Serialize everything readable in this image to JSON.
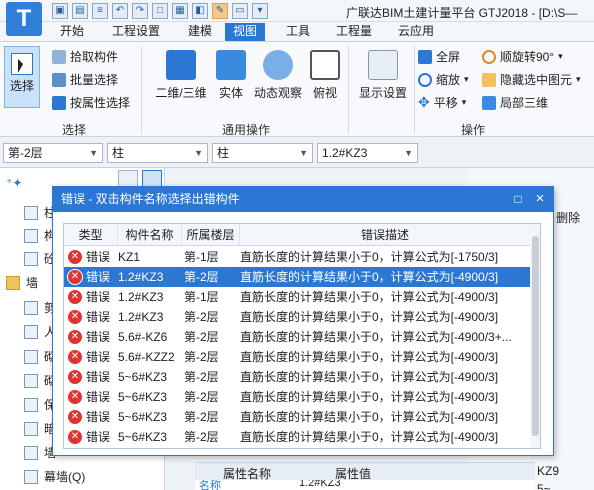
{
  "window": {
    "app_logo": "T",
    "title": "广联达BIM土建计量平台 GTJ2018 - [D:\\S—"
  },
  "menu": {
    "tabs": [
      "开始",
      "工程设置",
      "建模",
      "视图",
      "工具",
      "工程量",
      "云应用"
    ],
    "active_tab": "视图"
  },
  "ribbon": {
    "select_group": {
      "select_label": "选择",
      "pick_label": "拾取构件",
      "batch_label": "批量选择",
      "by_attr_label": "按属性选择",
      "group_label": "选择"
    },
    "general_group": {
      "view2d3d_label": "二维/三维",
      "solid_label": "实体",
      "dynamic_label": "动态观察",
      "top_view_label": "俯视",
      "group_label": "通用操作"
    },
    "display_group": {
      "display_settings_label": "显示设置"
    },
    "ops_group": {
      "fullscreen_label": "全屏",
      "zoom_label": "缩放",
      "pan_label": "平移",
      "rotate_label": "顺旋转90°",
      "hide_label": "隐藏选中图元",
      "local3d_label": "局部三维",
      "group_label": "操作"
    }
  },
  "selectors": {
    "floor": "第-2层",
    "category": "柱",
    "type": "柱",
    "component": "1.2#KZ3"
  },
  "left_tree": {
    "items": [
      "柱",
      "构",
      "砼",
      "墙",
      "剪",
      "人",
      "砌",
      "砌",
      "保",
      "暗",
      "墙",
      "幕墙(Q)"
    ]
  },
  "right_panel": {
    "delete_label": "删除",
    "kz_label_1": "KZ9",
    "kz_label_2": "5~"
  },
  "background_props": {
    "col_name": "属性名称",
    "col_value": "属性值",
    "row_name": "名称",
    "row_value": "1.2#KZ3"
  },
  "dialog": {
    "title": "错误 - 双击构件名称选择出错构件",
    "minimize_symbol": "□",
    "close_symbol": "×",
    "columns": [
      "类型",
      "构件名称",
      "所属楼层",
      "错误描述"
    ],
    "rows": [
      {
        "type": "错误",
        "name": "KZ1",
        "floor": "第-1层",
        "desc": "直筋长度的计算结果小于0，计算公式为[-1750/3]",
        "selected": false
      },
      {
        "type": "错误",
        "name": "1.2#KZ3",
        "floor": "第-2层",
        "desc": "直筋长度的计算结果小于0，计算公式为[-4900/3]",
        "selected": true
      },
      {
        "type": "错误",
        "name": "1.2#KZ3",
        "floor": "第-1层",
        "desc": "直筋长度的计算结果小于0，计算公式为[-4900/3]",
        "selected": false
      },
      {
        "type": "错误",
        "name": "1.2#KZ3",
        "floor": "第-2层",
        "desc": "直筋长度的计算结果小于0，计算公式为[-4900/3]",
        "selected": false
      },
      {
        "type": "错误",
        "name": "5.6#-KZ6",
        "floor": "第-2层",
        "desc": "直筋长度的计算结果小于0，计算公式为[-4900/3+...",
        "selected": false
      },
      {
        "type": "错误",
        "name": "5.6#-KZZ2",
        "floor": "第-2层",
        "desc": "直筋长度的计算结果小于0，计算公式为[-4900/3]",
        "selected": false
      },
      {
        "type": "错误",
        "name": "5~6#KZ3",
        "floor": "第-2层",
        "desc": "直筋长度的计算结果小于0，计算公式为[-4900/3]",
        "selected": false
      },
      {
        "type": "错误",
        "name": "5~6#KZ3",
        "floor": "第-2层",
        "desc": "直筋长度的计算结果小于0，计算公式为[-4900/3]",
        "selected": false
      },
      {
        "type": "错误",
        "name": "5~6#KZ3",
        "floor": "第-2层",
        "desc": "直筋长度的计算结果小于0，计算公式为[-4900/3]",
        "selected": false
      },
      {
        "type": "错误",
        "name": "5~6#KZ3",
        "floor": "第-2层",
        "desc": "直筋长度的计算结果小于0，计算公式为[-4900/3]",
        "selected": false
      }
    ]
  },
  "colors": {
    "accent": "#2b78d4",
    "error_red": "#e03434"
  }
}
